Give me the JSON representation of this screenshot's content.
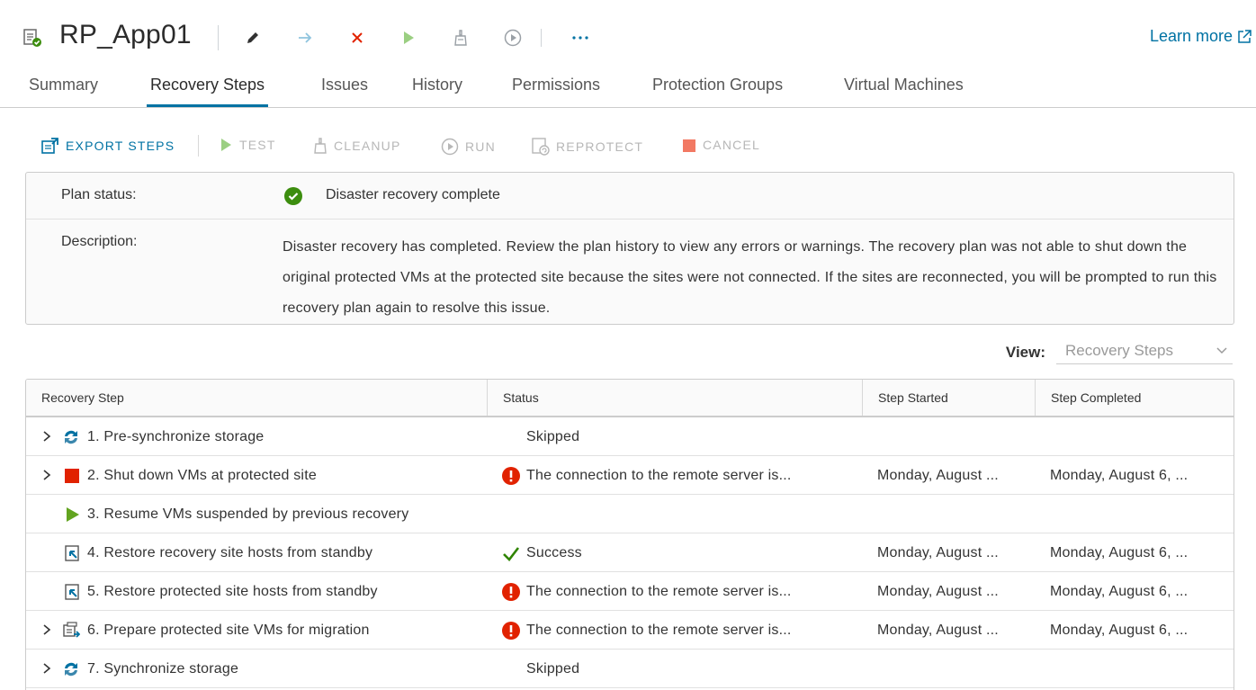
{
  "plan": {
    "title": "RP_App01",
    "learn_more": "Learn more"
  },
  "toolbar_icons": [
    "edit-icon",
    "move-icon",
    "delete-icon",
    "test-play-icon",
    "cleanup-icon",
    "run-icon",
    "more-icon"
  ],
  "tabs": [
    {
      "label": "Summary",
      "active": false
    },
    {
      "label": "Recovery Steps",
      "active": true
    },
    {
      "label": "Issues",
      "active": false
    },
    {
      "label": "History",
      "active": false
    },
    {
      "label": "Permissions",
      "active": false
    },
    {
      "label": "Protection Groups",
      "active": false
    },
    {
      "label": "Virtual Machines",
      "active": false
    }
  ],
  "actions": {
    "export": "EXPORT STEPS",
    "test": "TEST",
    "cleanup": "CLEANUP",
    "run": "RUN",
    "reprotect": "REPROTECT",
    "cancel": "CANCEL"
  },
  "info": {
    "plan_status_label": "Plan status:",
    "plan_status_value": "Disaster recovery complete",
    "description_label": "Description:",
    "description_value": "Disaster recovery has completed. Review the plan history to view any errors or warnings. The recovery plan was not able to shut down the original protected VMs at the protected site because the sites were not connected. If the sites are reconnected, you will be prompted to run this recovery plan again to resolve this issue."
  },
  "view": {
    "label": "View:",
    "selected": "Recovery Steps"
  },
  "grid": {
    "columns": [
      "Recovery Step",
      "Status",
      "Step Started",
      "Step Completed"
    ],
    "rows": [
      {
        "step": "1. Pre-synchronize storage",
        "icon": "sync-storage-icon",
        "expandable": true,
        "status": "Skipped",
        "status_icon": "",
        "started": "",
        "completed": ""
      },
      {
        "step": "2. Shut down VMs at protected site",
        "icon": "stop-icon",
        "expandable": true,
        "status": "The connection to the remote server is...",
        "status_icon": "error-icon",
        "started": "Monday, August ...",
        "completed": "Monday, August 6, ..."
      },
      {
        "step": "3. Resume VMs suspended by previous recovery",
        "icon": "play-icon",
        "expandable": false,
        "status": "",
        "status_icon": "",
        "started": "",
        "completed": ""
      },
      {
        "step": "4. Restore recovery site hosts from standby",
        "icon": "host-restore-icon",
        "expandable": false,
        "status": "Success",
        "status_icon": "check-icon",
        "started": "Monday, August ...",
        "completed": "Monday, August 6, ..."
      },
      {
        "step": "5. Restore protected site hosts from standby",
        "icon": "host-restore-icon",
        "expandable": false,
        "status": "The connection to the remote server is...",
        "status_icon": "error-icon",
        "started": "Monday, August ...",
        "completed": "Monday, August 6, ..."
      },
      {
        "step": "6. Prepare protected site VMs for migration",
        "icon": "vm-migrate-icon",
        "expandable": true,
        "status": "The connection to the remote server is...",
        "status_icon": "error-icon",
        "started": "Monday, August ...",
        "completed": "Monday, August 6, ..."
      },
      {
        "step": "7. Synchronize storage",
        "icon": "sync-storage-icon",
        "expandable": true,
        "status": "Skipped",
        "status_icon": "",
        "started": "",
        "completed": ""
      }
    ]
  },
  "colors": {
    "accent": "#0072a3",
    "error": "#e12200",
    "success": "#2f8400",
    "ok_badge": "#3c8d0e",
    "run_green": "#62a420",
    "cancel_red": "#f27963"
  }
}
